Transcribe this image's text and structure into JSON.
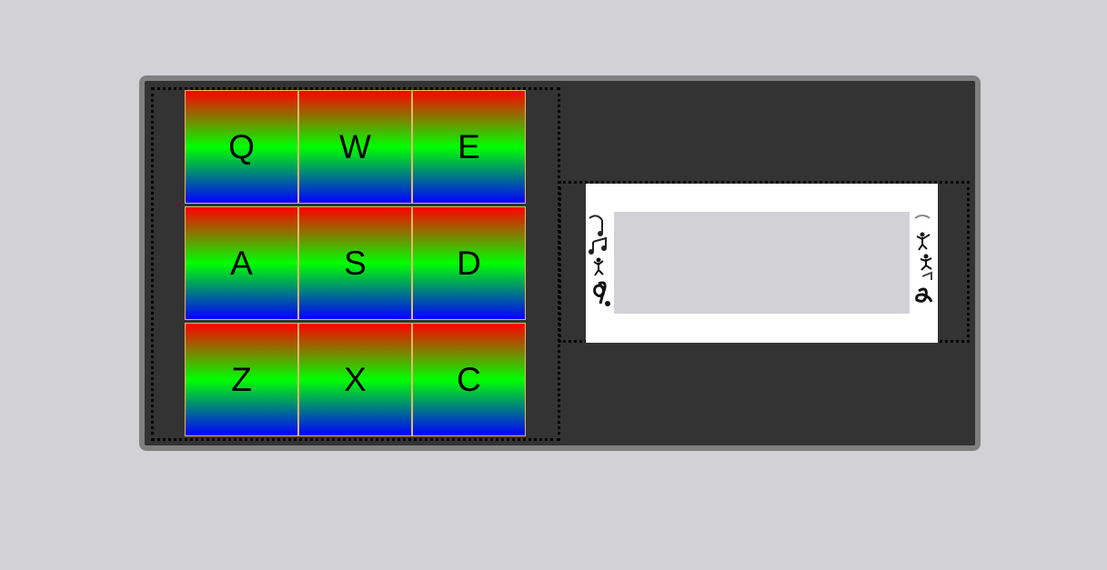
{
  "pads": [
    {
      "key": "Q"
    },
    {
      "key": "W"
    },
    {
      "key": "E"
    },
    {
      "key": "A"
    },
    {
      "key": "S"
    },
    {
      "key": "D"
    },
    {
      "key": "Z"
    },
    {
      "key": "X"
    },
    {
      "key": "C"
    }
  ],
  "display": {
    "text": ""
  },
  "colors": {
    "page_background": "#d2d1d6",
    "machine_background": "#333333",
    "machine_border": "#808080",
    "pad_gradient": [
      "#ff0000",
      "#00ff00",
      "#0000ff"
    ],
    "pad_border": "#e6b866",
    "display_frame": "#ffffff",
    "display_screen": "#d2d1d6"
  },
  "icons": {
    "display_decoration": "music-notes-dancers-icon"
  }
}
